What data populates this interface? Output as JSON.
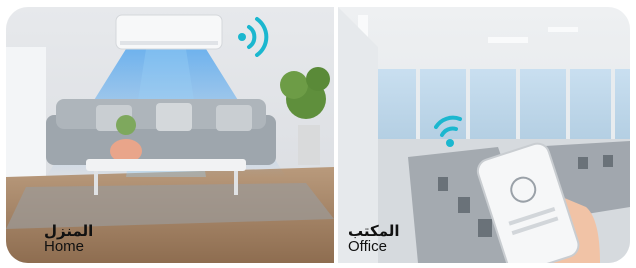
{
  "home": {
    "label_ar": "المنزل",
    "label_en": "Home",
    "wifi_icon": "wifi-signal-icon"
  },
  "office": {
    "label_ar": "المكتب",
    "label_en": "Office",
    "wifi_icon": "wifi-signal-icon"
  },
  "colors": {
    "wifi": "#1bb7cf",
    "airflow": "#7ec3f2"
  }
}
